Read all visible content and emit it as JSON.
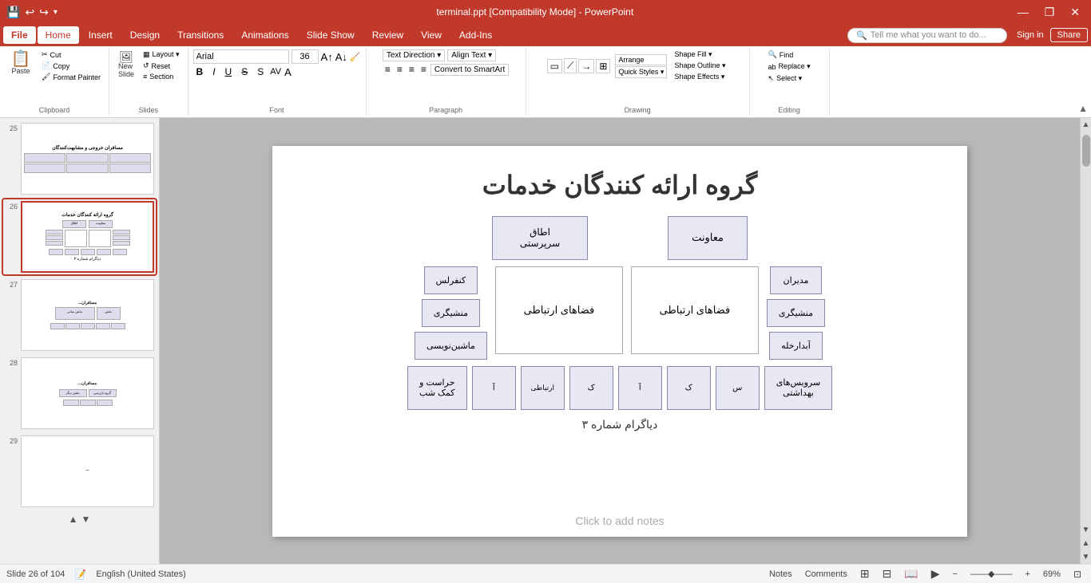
{
  "titlebar": {
    "title": "terminal.ppt [Compatibility Mode] - PowerPoint",
    "save_icon": "💾",
    "undo_icon": "↩",
    "redo_icon": "↪",
    "customize_icon": "⚙",
    "minimize": "—",
    "restore": "❐",
    "close": "✕"
  },
  "menubar": {
    "items": [
      "File",
      "Home",
      "Insert",
      "Design",
      "Transitions",
      "Animations",
      "Slide Show",
      "Review",
      "View",
      "Add-Ins"
    ]
  },
  "ribbon": {
    "groups": [
      {
        "name": "Clipboard",
        "buttons": [
          "Paste",
          "Cut",
          "Copy",
          "Format Painter"
        ]
      },
      {
        "name": "Slides",
        "buttons": [
          "New Slide",
          "Layout",
          "Reset",
          "Section"
        ]
      },
      {
        "name": "Font",
        "fontname": "Arial",
        "fontsize": "36"
      },
      {
        "name": "Paragraph"
      },
      {
        "name": "Drawing",
        "buttons": [
          "Arrange",
          "Quick Styles",
          "Shape Fill",
          "Shape Outline",
          "Shape Effects"
        ]
      },
      {
        "name": "Editing",
        "buttons": [
          "Find",
          "Replace",
          "Select"
        ]
      }
    ],
    "text_direction_label": "Text Direction",
    "align_text_label": "Align Text",
    "convert_smartart_label": "Convert to SmartArt"
  },
  "slides": [
    {
      "num": "25",
      "active": false,
      "title": "مسافران خروجی و مشابهت‌کنندگان",
      "has_diagram": true
    },
    {
      "num": "26",
      "active": true,
      "title": "گروه ارائه کنندگان خدمات",
      "has_diagram": true
    },
    {
      "num": "27",
      "active": false,
      "title": "",
      "has_diagram": true
    },
    {
      "num": "28",
      "active": false,
      "title": "",
      "has_diagram": true
    },
    {
      "num": "29",
      "active": false,
      "title": "",
      "has_diagram": false
    }
  ],
  "current_slide": {
    "title": "گروه ارائه کنندگان خدمات",
    "org_boxes": {
      "top_row": [
        "معاونت",
        "اطاق سرپرستی"
      ],
      "mid_left_col": [
        "مدیران",
        "منشیگری",
        "آبدارخله"
      ],
      "mid_center_left": "فضاهای ارتباطی",
      "mid_center_right": "فضاهای ارتباطی",
      "mid_right_col": [
        "کنفرلس",
        "منشیگری",
        "ماشین‌نویسی"
      ],
      "bottom_row": [
        "سرویس‌های بهداشتی",
        "س",
        "ک",
        "آ",
        "ک",
        "ارتباطی",
        "آ",
        "حراست و کمک شب"
      ]
    },
    "caption": "دیاگرام شماره ۳",
    "click_notes": "Click to add notes"
  },
  "statusbar": {
    "slide_info": "Slide 26 of 104",
    "language": "English (United States)",
    "notes_label": "Notes",
    "comments_label": "Comments",
    "zoom": "69%",
    "view_icons": [
      "normal",
      "slide-sorter",
      "reading",
      "slide-show"
    ]
  }
}
